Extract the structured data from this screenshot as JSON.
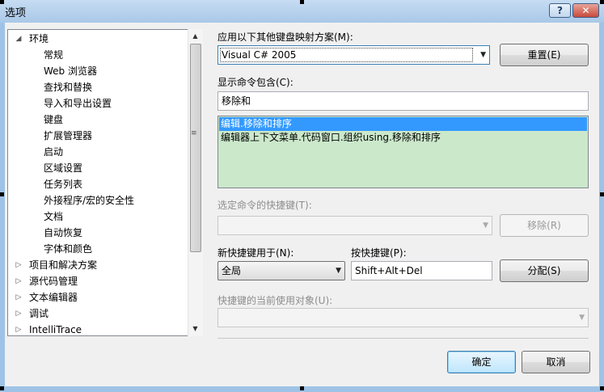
{
  "window": {
    "title": "选项",
    "help_label": "?",
    "close_label": "✕"
  },
  "tree": {
    "items": [
      {
        "label": "环境",
        "level": 0,
        "expanded": true
      },
      {
        "label": "常规",
        "level": 1
      },
      {
        "label": "Web 浏览器",
        "level": 1
      },
      {
        "label": "查找和替换",
        "level": 1
      },
      {
        "label": "导入和导出设置",
        "level": 1
      },
      {
        "label": "键盘",
        "level": 1,
        "selected": true
      },
      {
        "label": "扩展管理器",
        "level": 1
      },
      {
        "label": "启动",
        "level": 1
      },
      {
        "label": "区域设置",
        "level": 1
      },
      {
        "label": "任务列表",
        "level": 1
      },
      {
        "label": "外接程序/宏的安全性",
        "level": 1
      },
      {
        "label": "文档",
        "level": 1
      },
      {
        "label": "自动恢复",
        "level": 1
      },
      {
        "label": "字体和颜色",
        "level": 1
      },
      {
        "label": "项目和解决方案",
        "level": 0,
        "expanded": false
      },
      {
        "label": "源代码管理",
        "level": 0,
        "expanded": false
      },
      {
        "label": "文本编辑器",
        "level": 0,
        "expanded": false
      },
      {
        "label": "调试",
        "level": 0,
        "expanded": false
      },
      {
        "label": "IntelliTrace",
        "level": 0,
        "expanded": false
      }
    ]
  },
  "mapping": {
    "label": "应用以下其他键盘映射方案(M):",
    "value": "Visual C# 2005",
    "reset_label": "重置(E)"
  },
  "commands": {
    "label": "显示命令包含(C):",
    "filter_value": "移除和",
    "list": [
      {
        "text": "编辑.移除和排序",
        "selected": true
      },
      {
        "text": "编辑器上下文菜单.代码窗口.组织using.移除和排序",
        "selected": false
      }
    ]
  },
  "shortcuts": {
    "label": "选定命令的快捷键(T):",
    "value": "",
    "remove_label": "移除(R)"
  },
  "new_shortcut": {
    "scope_label": "新快捷键用于(N):",
    "scope_value": "全局",
    "press_label": "按快捷键(P):",
    "press_value": "Shift+Alt+Del",
    "assign_label": "分配(S)"
  },
  "current_use": {
    "label": "快捷键的当前使用对象(U):",
    "value": ""
  },
  "footer": {
    "ok_label": "确定",
    "cancel_label": "取消"
  },
  "colors": {
    "list_background": "#cbe8cb",
    "selection": "#3399ff",
    "titlebar": "#b8d3ee"
  }
}
